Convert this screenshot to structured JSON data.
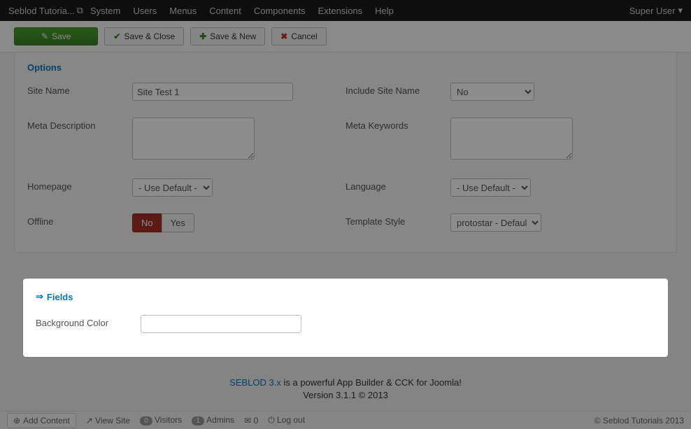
{
  "nav": {
    "brand": "Seblod Tutoria...",
    "items": [
      "System",
      "Users",
      "Menus",
      "Content",
      "Components",
      "Extensions",
      "Help"
    ],
    "user": "Super User"
  },
  "toolbar": {
    "save": "Save",
    "save_close": "Save & Close",
    "save_new": "Save & New",
    "cancel": "Cancel"
  },
  "options": {
    "heading": "Options",
    "site_name_label": "Site Name",
    "site_name_value": "Site Test 1",
    "include_label": "Include Site Name",
    "include_value": "No",
    "meta_desc_label": "Meta Description",
    "meta_desc_value": "",
    "meta_key_label": "Meta Keywords",
    "meta_key_value": "",
    "homepage_label": "Homepage",
    "homepage_value": "- Use Default -",
    "language_label": "Language",
    "language_value": "- Use Default -",
    "offline_label": "Offline",
    "offline_no": "No",
    "offline_yes": "Yes",
    "template_label": "Template Style",
    "template_value": "protostar - Default"
  },
  "fields": {
    "heading": "Fields",
    "bg_color_label": "Background Color",
    "bg_color_value": ""
  },
  "footer": {
    "line1a": "SEBLOD 3.x",
    "line1b": " is a powerful App Builder & CCK for Joomla!",
    "line2": "Version 3.1.1 © 2013"
  },
  "status": {
    "add": "Add Content",
    "view_site": "View Site",
    "visitors_n": "0",
    "visitors": "Visitors",
    "admins_n": "1",
    "admins": "Admins",
    "msgs": "0",
    "logout": "Log out",
    "copyright": "© Seblod Tutorials 2013"
  }
}
